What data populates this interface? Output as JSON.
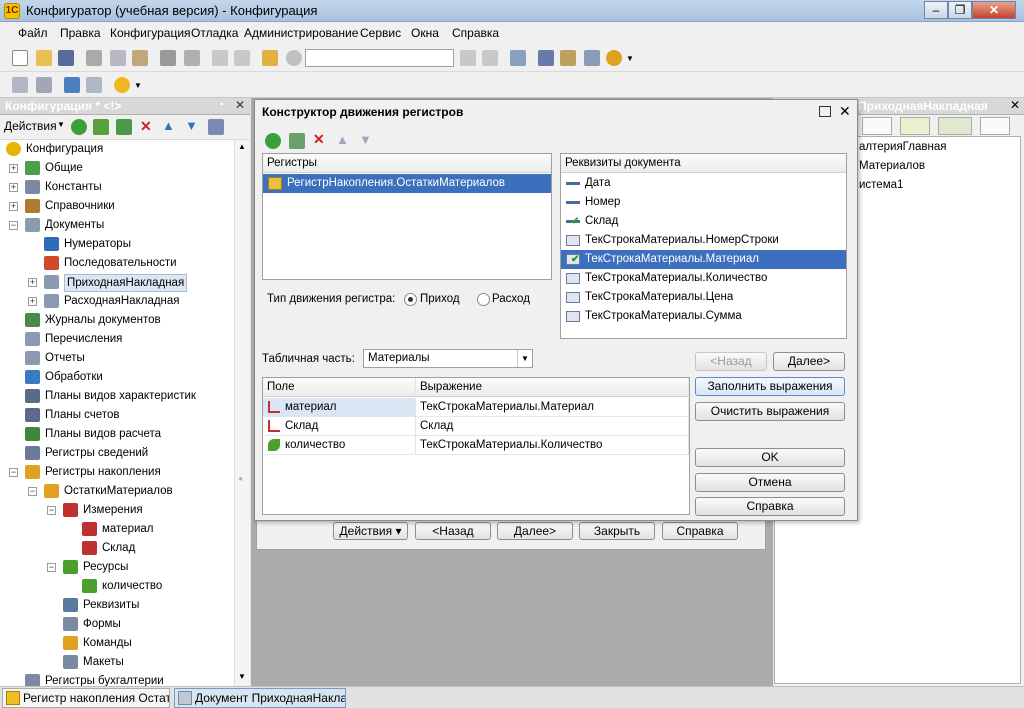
{
  "window": {
    "title": "Конфигуратор (учебная версия) - Конфигурация"
  },
  "menu": [
    "Файл",
    "Правка",
    "Конфигурация",
    "Отладка",
    "Администрирование",
    "Сервис",
    "Окна",
    "Справка"
  ],
  "left_panel": {
    "title": "Конфигурация * <!>",
    "actions_label": "Действия",
    "tree": [
      {
        "label": "Конфигурация",
        "icon": "config-icon",
        "color": "#e6b500"
      },
      {
        "label": "Общие",
        "icon": "common-icon",
        "color": "#4aa04a"
      },
      {
        "label": "Константы",
        "icon": "constants-icon",
        "color": "#7a8aa0"
      },
      {
        "label": "Справочники",
        "icon": "catalogs-icon",
        "color": "#b07a30"
      },
      {
        "label": "Документы",
        "icon": "documents-icon",
        "color": "#8a9ab0"
      },
      {
        "label": "Нумераторы",
        "icon": "numerators-icon",
        "color": "#2e6ab8"
      },
      {
        "label": "Последовательности",
        "icon": "sequences-icon",
        "color": "#d04a2a"
      },
      {
        "label": "ПриходнаяНакладная",
        "icon": "document-icon",
        "color": "#8a9ab0"
      },
      {
        "label": "РасходнаяНакладная",
        "icon": "document-icon",
        "color": "#8a9ab0"
      },
      {
        "label": "Журналы документов",
        "icon": "journals-icon",
        "color": "#4a8a4a"
      },
      {
        "label": "Перечисления",
        "icon": "enums-icon",
        "color": "#8a9ab0"
      },
      {
        "label": "Отчеты",
        "icon": "reports-icon",
        "color": "#8a9ab0"
      },
      {
        "label": "Обработки",
        "icon": "processors-icon",
        "color": "#3a7ac0"
      },
      {
        "label": "Планы видов характеристик",
        "icon": "chart-of-char-icon",
        "color": "#5a6a8a"
      },
      {
        "label": "Планы счетов",
        "icon": "chart-of-accounts-icon",
        "color": "#5a6a8a"
      },
      {
        "label": "Планы видов расчета",
        "icon": "chart-of-calc-icon",
        "color": "#3a8a3a"
      },
      {
        "label": "Регистры сведений",
        "icon": "info-registers-icon",
        "color": "#6a7a9a"
      },
      {
        "label": "Регистры накопления",
        "icon": "accum-registers-icon",
        "color": "#e0a020"
      },
      {
        "label": "ОстаткиМатериалов",
        "icon": "register-icon",
        "color": "#e0a020"
      },
      {
        "label": "Измерения",
        "icon": "dimensions-icon",
        "color": "#c03030"
      },
      {
        "label": "материал",
        "icon": "dimension-icon",
        "color": "#c03030"
      },
      {
        "label": "Склад",
        "icon": "dimension-icon",
        "color": "#c03030"
      },
      {
        "label": "Ресурсы",
        "icon": "resources-icon",
        "color": "#4aa02a"
      },
      {
        "label": "количество",
        "icon": "resource-icon",
        "color": "#4aa02a"
      },
      {
        "label": "Реквизиты",
        "icon": "attributes-icon",
        "color": "#5a7aa0"
      },
      {
        "label": "Формы",
        "icon": "forms-icon",
        "color": "#7a8aa0"
      },
      {
        "label": "Команды",
        "icon": "commands-icon",
        "color": "#e0a020"
      },
      {
        "label": "Макеты",
        "icon": "templates-icon",
        "color": "#7a8aa0"
      },
      {
        "label": "Регистры бухгалтерии",
        "icon": "accounting-registers-icon",
        "color": "#7a8aa0"
      }
    ]
  },
  "right_panel": {
    "title": "ПриходнаяНакладная",
    "items": [
      "алтерияГлавная",
      "Материалов",
      "истема1"
    ]
  },
  "behind_form": {
    "buttons": [
      "Действия",
      "<Назад",
      "Далее>",
      "Закрыть",
      "Справка"
    ]
  },
  "dialog": {
    "title": "Конструктор движения регистров",
    "registers_header": "Регистры",
    "registers": [
      "РегистрНакопления.ОстаткиМатериалов"
    ],
    "movement_type_label": "Тип движения регистра:",
    "movement_income": "Приход",
    "movement_expense": "Расход",
    "doc_attrs_header": "Реквизиты документа",
    "doc_attrs": [
      {
        "label": "Дата",
        "icon": "attribute-icon"
      },
      {
        "label": "Номер",
        "icon": "attribute-icon"
      },
      {
        "label": "Склад",
        "icon": "attribute-check-icon"
      },
      {
        "label": "ТекСтрокаМатериалы.НомерСтроки",
        "icon": "tabular-attr-icon"
      },
      {
        "label": "ТекСтрокаМатериалы.Материал",
        "icon": "tabular-attr-check-icon"
      },
      {
        "label": "ТекСтрокаМатериалы.Количество",
        "icon": "tabular-attr-icon"
      },
      {
        "label": "ТекСтрокаМатериалы.Цена",
        "icon": "tabular-attr-icon"
      },
      {
        "label": "ТекСтрокаМатериалы.Сумма",
        "icon": "tabular-attr-icon"
      }
    ],
    "tabular_label": "Табличная часть:",
    "tabular_value": "Материалы",
    "back_btn": "<Назад",
    "next_btn": "Далее>",
    "fill_btn": "Заполнить выражения",
    "clear_btn": "Очистить выражения",
    "ok_btn": "OK",
    "cancel_btn": "Отмена",
    "help_btn": "Справка",
    "grid_headers": [
      "Поле",
      "Выражение"
    ],
    "grid_rows": [
      {
        "field": "материал",
        "expr": "ТекСтрокаМатериалы.Материал",
        "icon": "dimension-icon"
      },
      {
        "field": "Склад",
        "expr": "Склад",
        "icon": "dimension-icon"
      },
      {
        "field": "количество",
        "expr": "ТекСтрокаМатериалы.Количество",
        "icon": "resource-icon"
      }
    ]
  },
  "status_tabs": [
    "Регистр накопления Остат...",
    "Документ ПриходнаяНакла..."
  ]
}
